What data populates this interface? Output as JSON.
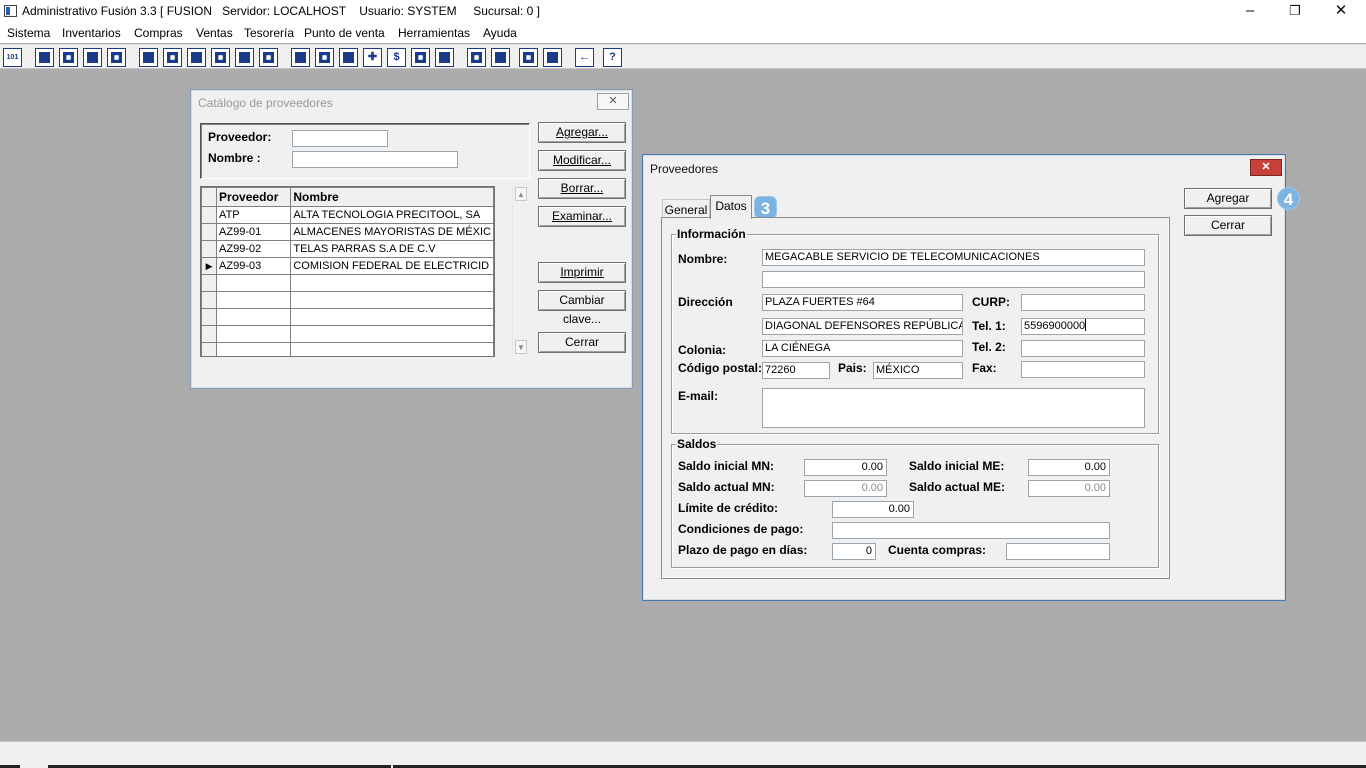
{
  "window": {
    "title": "Administrativo Fusión 3.3 [ FUSION   Servidor: LOCALHOST    Usuario: SYSTEM     Sucursal: 0 ]",
    "minimize_glyph": "–",
    "maximize_glyph": "❐",
    "close_glyph": "✕"
  },
  "menu": [
    "Sistema",
    "Inventarios",
    "Compras",
    "Ventas",
    "Tesorería",
    "Punto de venta",
    "Herramientas",
    "Ayuda"
  ],
  "toolbar": {
    "icons": [
      "calculator-icon",
      "copy-icon",
      "clipboard-icon",
      "exchange-icon",
      "search-doc-icon",
      "user-icon",
      "folder-icon",
      "print-preview-icon",
      "printer-icon",
      "document-icon",
      "list-icon",
      "binoculars-icon",
      "box-icon",
      "export-icon",
      "add-icon",
      "money-icon",
      "invoice-icon",
      "report-icon",
      "home-icon",
      "zoom-icon",
      "refresh-icon",
      "undo-icon",
      "back-arrow-icon",
      "help-icon"
    ],
    "glyphs": [
      "101",
      "",
      "",
      "",
      "",
      "",
      "",
      "",
      "",
      "",
      "",
      "",
      "",
      "",
      "✚",
      "$",
      "",
      "",
      "",
      "",
      "",
      "",
      "←",
      "?"
    ]
  },
  "catalog": {
    "title": "Catálogo de proveedores",
    "close_glyph": "✕",
    "proveedor_label": "Proveedor:",
    "proveedor_value": "",
    "nombre_label": "Nombre :",
    "nombre_value": "",
    "columns": [
      "Proveedor",
      "Nombre"
    ],
    "rows": [
      {
        "indicator": "",
        "proveedor": "ATP",
        "nombre": "ALTA TECNOLOGIA PRECITOOL, SA"
      },
      {
        "indicator": "",
        "proveedor": "AZ99-01",
        "nombre": "ALMACENES MAYORISTAS DE MÉXIC"
      },
      {
        "indicator": "",
        "proveedor": "AZ99-02",
        "nombre": "TELAS PARRAS S.A DE C.V"
      },
      {
        "indicator": "▶",
        "proveedor": "AZ99-03",
        "nombre": "COMISION FEDERAL DE ELECTRICID"
      }
    ],
    "buttons": {
      "agregar": "Agregar...",
      "modificar": "Modificar...",
      "borrar": "Borrar...",
      "examinar": "Examinar...",
      "imprimir": "Imprimir",
      "cambiar_clave": "Cambiar clave...",
      "cerrar": "Cerrar"
    },
    "scroll_up": "▲",
    "scroll_down": "▼"
  },
  "proveedores": {
    "title": "Proveedores",
    "close_glyph": "✕",
    "tabs": [
      "General",
      "Datos"
    ],
    "active_tab": "Datos",
    "tab_badge": "3",
    "agregar_badge": "4",
    "buttons": {
      "agregar": "Agregar",
      "cerrar": "Cerrar"
    },
    "informacion": {
      "caption": "Información",
      "nombre_label": "Nombre:",
      "nombre_1": "MEGACABLE SERVICIO DE TELECOMUNICACIONES",
      "nombre_2": "",
      "direccion_label": "Dirección",
      "direccion_1": "PLAZA FUERTES #64",
      "direccion_2": "DIAGONAL DEFENSORES REPÚBLICA",
      "curp_label": "CURP:",
      "curp": "",
      "tel1_label": "Tel. 1:",
      "tel1": "5596900000",
      "tel2_label": "Tel. 2:",
      "tel2": "",
      "colonia_label": "Colonia:",
      "colonia": "LA CIÉNEGA",
      "cp_label": "Código postal:",
      "cp": "72260",
      "pais_label": "Pais:",
      "pais": "MÉXICO",
      "fax_label": "Fax:",
      "fax": "",
      "email_label": "E-mail:",
      "email": ""
    },
    "saldos": {
      "caption": "Saldos",
      "saldo_inicial_mn_label": "Saldo inicial MN:",
      "saldo_inicial_mn": "0.00",
      "saldo_inicial_me_label": "Saldo inicial ME:",
      "saldo_inicial_me": "0.00",
      "saldo_actual_mn_label": "Saldo actual MN:",
      "saldo_actual_mn": "0.00",
      "saldo_actual_me_label": "Saldo actual ME:",
      "saldo_actual_me": "0.00",
      "limite_label": "Límite de crédito:",
      "limite": "0.00",
      "condiciones_label": "Condiciones de pago:",
      "condiciones": "",
      "plazo_label": "Plazo de pago en días:",
      "plazo": "0",
      "cuenta_label": "Cuenta compras:",
      "cuenta": ""
    }
  }
}
